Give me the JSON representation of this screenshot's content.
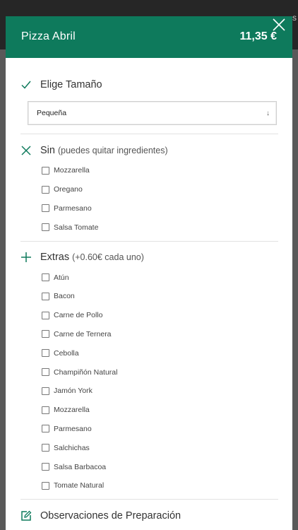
{
  "modal": {
    "title": "Pizza Abril",
    "price": "11,35 €"
  },
  "size_section": {
    "title": "Elige Tamaño",
    "selected": "Pequeña"
  },
  "without_section": {
    "title": "Sin",
    "subtitle": "(puedes quitar ingredientes)",
    "options": [
      "Mozzarella",
      "Oregano",
      "Parmesano",
      "Salsa Tomate"
    ]
  },
  "extras_section": {
    "title": "Extras",
    "subtitle": "(+0.60€ cada uno)",
    "options": [
      "Atún",
      "Bacon",
      "Carne de Pollo",
      "Carne de Ternera",
      "Cebolla",
      "Champiñón Natural",
      "Jamón York",
      "Mozzarella",
      "Parmesano",
      "Salchichas",
      "Salsa Barbacoa",
      "Tomate Natural"
    ]
  },
  "notes_section": {
    "title": "Observaciones de Preparación"
  },
  "colors": {
    "brand": "#0e7a5c",
    "accent_icon": "#0e7a5c"
  }
}
